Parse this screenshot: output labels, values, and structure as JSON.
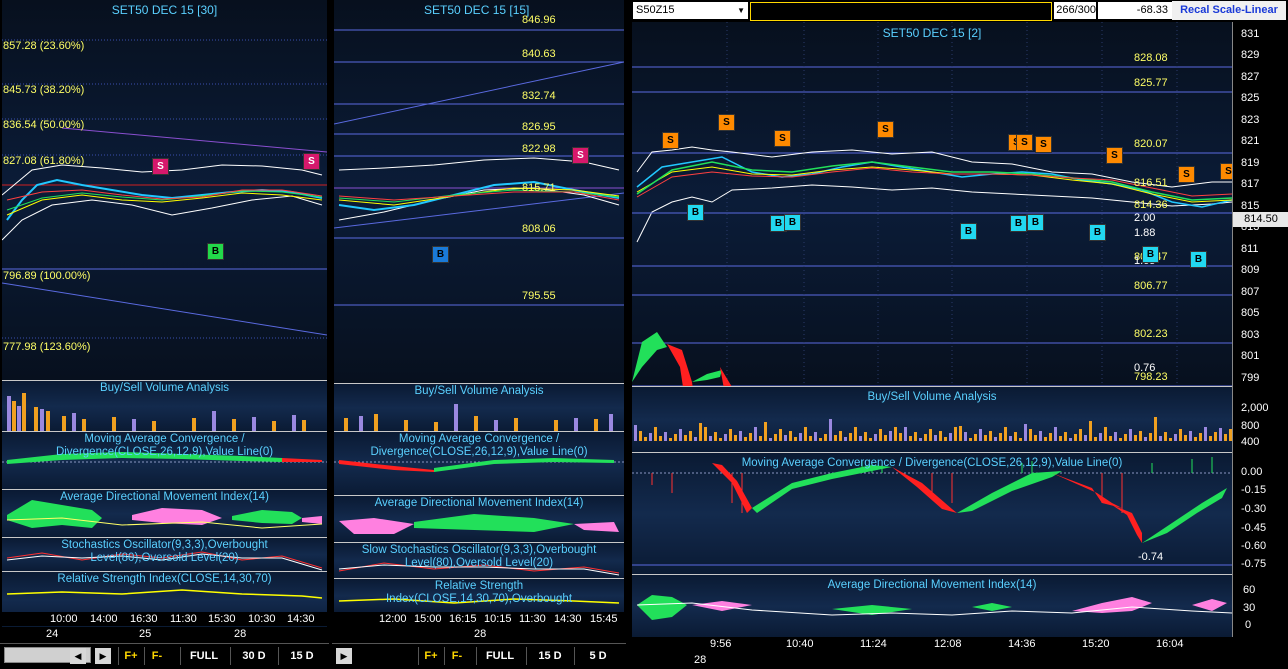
{
  "p1": {
    "title": "SET50 DEC 15  [30]",
    "fib": [
      "857.28 (23.60%)",
      "845.73 (38.20%)",
      "836.54 (50.00%)",
      "827.08 (61.80%)",
      "796.89 (100.00%)",
      "777.98 (123.60%)"
    ],
    "subs": [
      "Buy/Sell Volume Analysis",
      "Moving Average Convergence / Divergence(CLOSE,26,12,9),Value Line(0)",
      "Average Directional Movement Index(14)",
      "Stochastics Oscillator(9,3,3),Overbought Level(80),Oversold Level(20)",
      "Relative Strength Index(CLOSE,14,30,70)"
    ],
    "times": [
      "10:00",
      "14:00",
      "16:30",
      "11:30",
      "15:30",
      "10:30",
      "14:30"
    ],
    "dates": [
      "24",
      "25",
      "28"
    ],
    "buttons": [
      "F+",
      "F-",
      "FULL",
      "30 D",
      "15 D"
    ],
    "signals": [
      "S",
      "S",
      "B"
    ]
  },
  "p2": {
    "title": "SET50 DEC 15  [15]",
    "levels": [
      "846.96",
      "840.63",
      "832.74",
      "826.95",
      "822.98",
      "815.71",
      "808.06",
      "795.55"
    ],
    "subs": [
      "Buy/Sell Volume Analysis",
      "Moving Average Convergence / Divergence(CLOSE,26,12,9),Value Line(0)",
      "Average Directional Movement Index(14)",
      "Slow Stochastics Oscillator(9,3,3),Overbought Level(80),Oversold Level(20)",
      "Relative Strength Index(CLOSE,14,30,70),Overbought"
    ],
    "times": [
      "12:00",
      "15:00",
      "16:15",
      "10:15",
      "11:30",
      "14:30",
      "15:45"
    ],
    "dates": [
      "28"
    ],
    "buttons": [
      "F+",
      "F-",
      "FULL",
      "15 D",
      "5 D"
    ],
    "signals": [
      "S",
      "B"
    ]
  },
  "p3": {
    "symbol": "S50Z15",
    "count": "266/300",
    "change": "-68.33",
    "recal": "Recal Scale-Linear",
    "title": "SET50 DEC 15  [2]",
    "levels": [
      "828.08",
      "825.77",
      "820.07",
      "816.51",
      "814.36",
      "809.47",
      "806.77",
      "802.23",
      "798.23"
    ],
    "ratios": [
      "2.00",
      "1.88",
      "1.65",
      "0.76"
    ],
    "last_price": "814.50",
    "yaxis": [
      "831",
      "829",
      "827",
      "825",
      "823",
      "821",
      "819",
      "817",
      "815",
      "813",
      "811",
      "809",
      "807",
      "805",
      "803",
      "801",
      "799"
    ],
    "vol_axis": [
      "2,000",
      "800",
      "400"
    ],
    "vol_title": "Buy/Sell Volume Analysis",
    "macd_title": "Moving Average Convergence / Divergence(CLOSE,26,12,9),Value Line(0)",
    "macd_axis": [
      "0.00",
      "-0.15",
      "-0.30",
      "-0.45",
      "-0.60",
      "-0.75"
    ],
    "macd_value": "-0.74",
    "adx_title": "Average Directional Movement Index(14)",
    "adx_axis": [
      "60",
      "30",
      "0"
    ],
    "times": [
      "9:56",
      "10:40",
      "11:24",
      "12:08",
      "14:36",
      "15:20",
      "16:04"
    ],
    "dates": [
      "28"
    ],
    "sell_signals": [
      "S",
      "S",
      "S",
      "S",
      "S",
      "S",
      "S",
      "S",
      "S",
      "S",
      "S"
    ],
    "buy_signals": [
      "B",
      "B",
      "B",
      "B",
      "B",
      "B",
      "B",
      "B",
      "B"
    ]
  },
  "colors": {
    "fib": "#ffff66",
    "title": "#5ad0ff",
    "sell": "#ff8a00",
    "buy": "#22d8f0",
    "sell_p1": "#d6186c",
    "buy_p1": "#22d84a"
  }
}
